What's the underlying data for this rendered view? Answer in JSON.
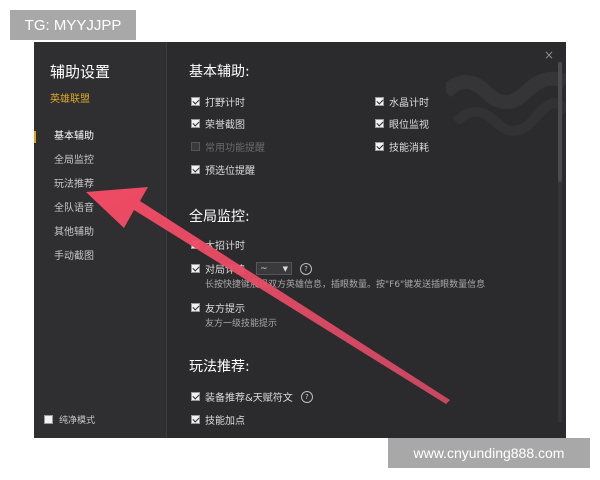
{
  "overlay": {
    "tag_label": "TG: MYYJJPP",
    "watermark": "www.cnyunding888.com"
  },
  "sidebar": {
    "title": "辅助设置",
    "game": "英雄联盟",
    "items": [
      {
        "label": "基本辅助",
        "active": true
      },
      {
        "label": "全局监控",
        "active": false
      },
      {
        "label": "玩法推荐",
        "active": false
      },
      {
        "label": "全队语音",
        "active": false
      },
      {
        "label": "其他辅助",
        "active": false
      },
      {
        "label": "手动截图",
        "active": false
      }
    ],
    "pure_mode": {
      "label": "纯净模式",
      "checked": false
    }
  },
  "main": {
    "close_glyph": "×",
    "sections": {
      "basic": {
        "title": "基本辅助:",
        "left": [
          {
            "label": "打野计时",
            "checked": true
          },
          {
            "label": "荣誉截图",
            "checked": true
          },
          {
            "label": "常用功能提醒",
            "checked": false,
            "disabled": true
          },
          {
            "label": "预选位提醒",
            "checked": true
          }
        ],
        "right": [
          {
            "label": "水晶计时",
            "checked": true
          },
          {
            "label": "眼位监视",
            "checked": true
          },
          {
            "label": "技能消耗",
            "checked": true
          }
        ]
      },
      "global": {
        "title": "全局监控:",
        "ult_timer": {
          "label": "大招计时",
          "checked": true
        },
        "details": {
          "label": "对局详情",
          "checked": true,
          "dropdown_value": "~"
        },
        "details_desc": "长按快捷键展现双方英雄信息，插眼数量。按\"F6\"键发送插眼数量信息",
        "ally_tips": {
          "label": "友方提示",
          "checked": true
        },
        "ally_tips_desc": "友方一级技能提示"
      },
      "play": {
        "title": "玩法推荐:",
        "equip": {
          "label": "装备推荐&天赋符文",
          "checked": true
        },
        "skill": {
          "label": "技能加点",
          "checked": true
        }
      }
    }
  },
  "colors": {
    "accent": "#d9a628",
    "arrow": "#e8475f",
    "window_bg": "#2b2b2d",
    "sidebar_bg": "#2f2f32"
  },
  "icons": {
    "close": "close-icon",
    "help": "help-icon",
    "arrow": "arrow-annotation-icon"
  }
}
